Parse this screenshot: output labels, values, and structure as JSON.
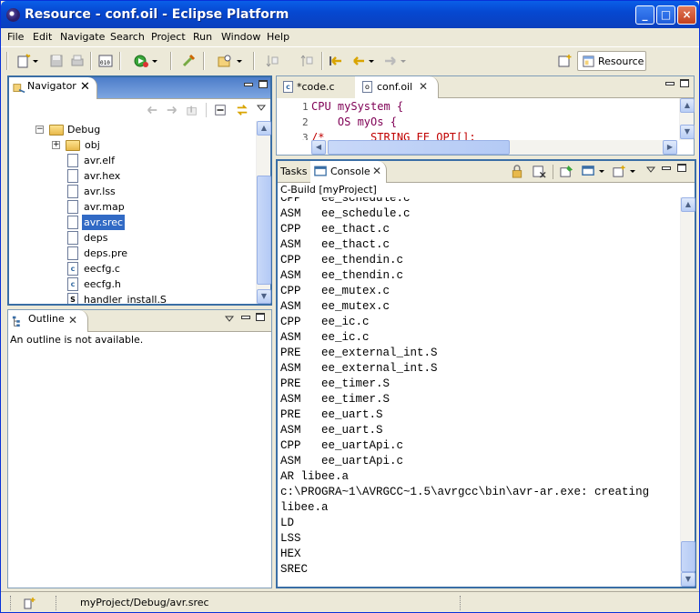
{
  "window": {
    "title": "Resource - conf.oil - Eclipse Platform",
    "controls": {
      "minimize": "_",
      "maximize": "□",
      "close": "×"
    }
  },
  "menubar": [
    "File",
    "Edit",
    "Navigate",
    "Search",
    "Project",
    "Run",
    "Window",
    "Help"
  ],
  "toolbar": {
    "perspective_label": "Resource"
  },
  "navigator": {
    "tab_label": "Navigator",
    "items": [
      {
        "label": "Debug",
        "type": "folder",
        "indent": 0,
        "expander": "−"
      },
      {
        "label": "obj",
        "type": "folder",
        "indent": 1,
        "expander": "+"
      },
      {
        "label": "avr.elf",
        "type": "file",
        "indent": 1
      },
      {
        "label": "avr.hex",
        "type": "file",
        "indent": 1
      },
      {
        "label": "avr.lss",
        "type": "file",
        "indent": 1
      },
      {
        "label": "avr.map",
        "type": "file",
        "indent": 1
      },
      {
        "label": "avr.srec",
        "type": "file",
        "indent": 1,
        "selected": true
      },
      {
        "label": "deps",
        "type": "file",
        "indent": 1
      },
      {
        "label": "deps.pre",
        "type": "file",
        "indent": 1
      },
      {
        "label": "eecfg.c",
        "type": "c-file",
        "indent": 1
      },
      {
        "label": "eecfg.h",
        "type": "c-file",
        "indent": 1
      },
      {
        "label": "handler_install.S",
        "type": "s-file",
        "indent": 1
      }
    ]
  },
  "outline": {
    "tab_label": "Outline",
    "message": "An outline is not available."
  },
  "editor": {
    "tabs": [
      {
        "label": "*code.c",
        "active": false
      },
      {
        "label": "conf.oil",
        "active": true
      }
    ],
    "lines": [
      {
        "num": "1",
        "text": "CPU mySystem {"
      },
      {
        "num": "2",
        "text": "    OS myOs {"
      },
      {
        "num": "3",
        "text": "/*       STRING EE_OPT[];"
      }
    ]
  },
  "console": {
    "tabs": [
      {
        "label": "Tasks",
        "active": false
      },
      {
        "label": "Console",
        "active": true
      }
    ],
    "header": "C-Build [myProject]",
    "lines": [
      "CPP   ee_schedule.c",
      "ASM   ee_schedule.c",
      "CPP   ee_thact.c",
      "ASM   ee_thact.c",
      "CPP   ee_thendin.c",
      "ASM   ee_thendin.c",
      "CPP   ee_mutex.c",
      "ASM   ee_mutex.c",
      "CPP   ee_ic.c",
      "ASM   ee_ic.c",
      "PRE   ee_external_int.S",
      "ASM   ee_external_int.S",
      "PRE   ee_timer.S",
      "ASM   ee_timer.S",
      "PRE   ee_uart.S",
      "ASM   ee_uart.S",
      "CPP   ee_uartApi.c",
      "ASM   ee_uartApi.c",
      "AR libee.a",
      "c:\\PROGRA~1\\AVRGCC~1.5\\avrgcc\\bin\\avr-ar.exe: creating",
      "libee.a",
      "LD",
      "LSS",
      "HEX",
      "SREC"
    ]
  },
  "statusbar": {
    "path": "myProject/Debug/avr.srec"
  },
  "colors": {
    "selection": "#316AC5",
    "title_bar": "#0A5FE8",
    "active_view_border": "#3A6EA5"
  }
}
